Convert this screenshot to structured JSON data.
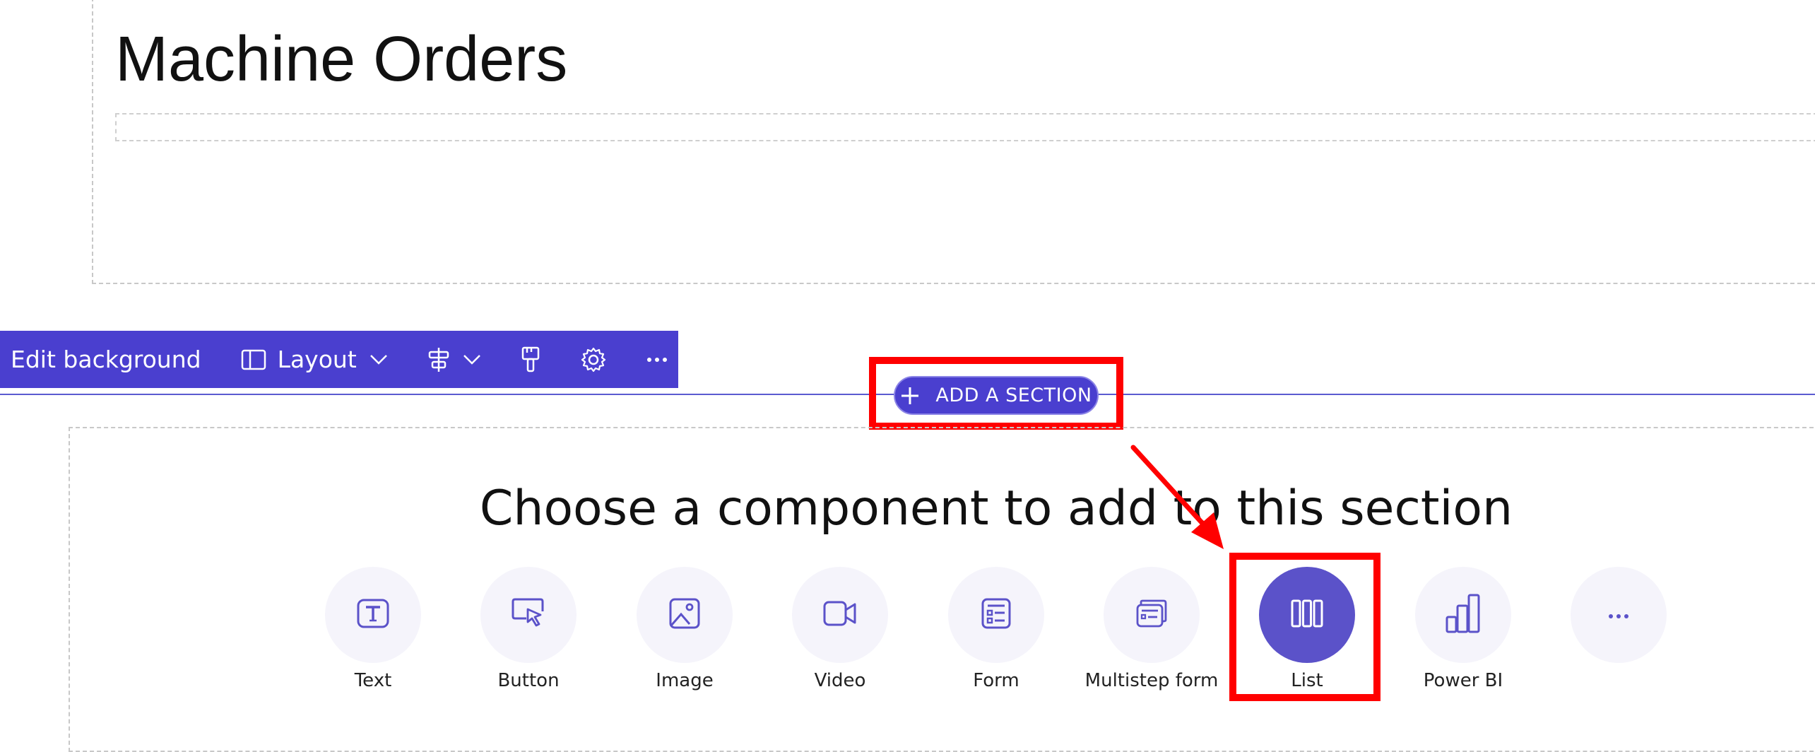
{
  "page": {
    "title": "Machine Orders"
  },
  "toolbar": {
    "edit_background_label": "Edit background",
    "layout_label": "Layout",
    "icons": [
      "layout-icon",
      "chevron-down-icon",
      "align-icon",
      "chevron-down-icon",
      "paint-brush-icon",
      "gear-icon",
      "more-icon"
    ]
  },
  "add_section": {
    "label": "ADD A SECTION",
    "icon": "plus-icon"
  },
  "component_picker": {
    "title": "Choose a component to add to this section",
    "components": [
      {
        "label": "Text",
        "icon": "text-icon"
      },
      {
        "label": "Button",
        "icon": "button-icon"
      },
      {
        "label": "Image",
        "icon": "image-icon"
      },
      {
        "label": "Video",
        "icon": "video-icon"
      },
      {
        "label": "Form",
        "icon": "form-icon"
      },
      {
        "label": "Multistep form",
        "icon": "multistep-form-icon"
      },
      {
        "label": "List",
        "icon": "list-icon",
        "selected": true
      },
      {
        "label": "Power BI",
        "icon": "power-bi-icon"
      },
      {
        "label": "",
        "icon": "more-icon"
      }
    ]
  },
  "colors": {
    "accent": "#4a3fcf",
    "tile_bg": "#f5f4fb",
    "selected_tile": "#5b52c9",
    "annotation": "#ff0000"
  }
}
